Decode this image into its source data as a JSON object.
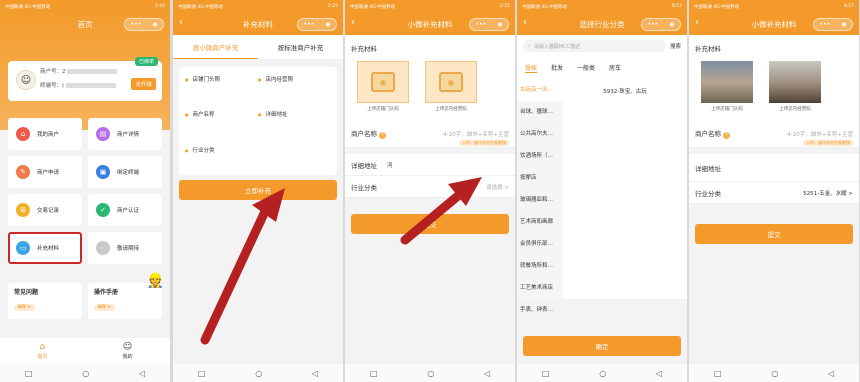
{
  "status": {
    "carrier": "中国联通 4G·中国移动",
    "time_1": "2:16",
    "time_2": "2:25",
    "time_3": "8:57",
    "time_4": "8:57"
  },
  "capsule": {
    "dots": "•••",
    "target": "◉"
  },
  "panel1": {
    "title": "首页",
    "card": {
      "merchant_no_label": "商户号：",
      "merchant_no_value": "2",
      "terminal_label": "终端号：",
      "terminal_value": "(",
      "bound_tag": "已绑单",
      "upgrade": "去升级"
    },
    "tiles": [
      {
        "label": "我的商户",
        "color": "#ef5b4a",
        "icon": "⌂"
      },
      {
        "label": "商户详情",
        "color": "#b56ee8",
        "icon": "▤"
      },
      {
        "label": "商户申请",
        "color": "#f07a4a",
        "icon": "✎"
      },
      {
        "label": "绑定终端",
        "color": "#3a7ee8",
        "icon": "▣"
      },
      {
        "label": "交易记录",
        "color": "#f3b12a",
        "icon": "≣"
      },
      {
        "label": "商户认证",
        "color": "#2bb673",
        "icon": "✓"
      },
      {
        "label": "补充材料",
        "color": "#3aa6e8",
        "icon": "▭"
      },
      {
        "label": "敬请期待",
        "color": "#c8c8c8",
        "icon": "⋯"
      }
    ],
    "faq": [
      {
        "label": "常见问题",
        "go": "GO >"
      },
      {
        "label": "操作手册",
        "go": "GO >"
      }
    ],
    "tabbar": [
      {
        "label": "首页"
      },
      {
        "label": "我的"
      }
    ]
  },
  "panel2": {
    "title": "补充材料",
    "segments": [
      "按小微商户补充",
      "按标准商户补充"
    ],
    "items": [
      "店铺门头照",
      "店内经营照",
      "商户名称",
      "详细地址",
      "行业分类"
    ],
    "submit": "立即补充"
  },
  "panel3": {
    "title": "小微补充材料",
    "section": "补充材料",
    "photos": [
      "上传店铺门头照",
      "上传店内经营照"
    ],
    "rows": [
      {
        "label": "商户名称",
        "value": "4-20字，城市+名称+主营",
        "hint": "示例：福州市金利来眼镜"
      },
      {
        "label": "详细地址",
        "value": "河"
      },
      {
        "label": "行业分类",
        "value": "请选择 >"
      }
    ],
    "submit": "提交"
  },
  "panel4": {
    "title": "选择行业分类",
    "search_placeholder": "请输入猫联MCC描述",
    "search_btn": "搜索",
    "tabs": [
      "餐娱",
      "批发",
      "一般类",
      "房车"
    ],
    "left": [
      "古玩店一出…",
      "台球、撞球…",
      "公共高尔夫…",
      "饮酒场所（…",
      "按摩店",
      "玻璃器皿和…",
      "艺术商和画廊",
      "会员俱乐部…",
      "就餐场所和…",
      "工艺美术商店",
      "手表、钟表…"
    ],
    "right": "5932-珠宝、古玩",
    "confirm": "确定"
  },
  "panel5": {
    "title": "小微补充材料",
    "section": "补充材料",
    "photos": [
      "上传店铺门头照",
      "上传店内经营照"
    ],
    "rows": [
      {
        "label": "商户名称",
        "value": "4-20字，城市+名称+主营",
        "hint": "示例：福州市金利来眼镜"
      },
      {
        "label": "详细地址",
        "value": ""
      },
      {
        "label": "行业分类",
        "value": "5251-五金、水暖 >"
      }
    ],
    "submit": "提交"
  },
  "nav": {
    "square": "□",
    "circle": "○",
    "back": "◁"
  }
}
